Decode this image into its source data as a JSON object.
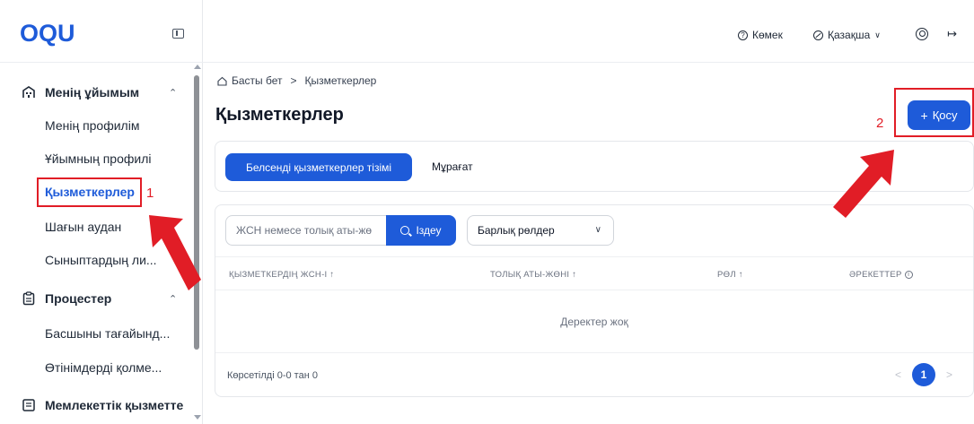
{
  "brand": {
    "logo": "OQU"
  },
  "header": {
    "help": "Көмек",
    "language": "Қазақша"
  },
  "sidebar": {
    "groups": [
      {
        "label": "Менің ұйымым",
        "items": [
          "Менің профилім",
          "Ұйымның профилі",
          "Қызметкерлер",
          "Шағын аудан",
          "Сыныптардың ли..."
        ]
      },
      {
        "label": "Процестер",
        "items": [
          "Басшыны тағайынд...",
          "Өтінімдерді қолме..."
        ]
      },
      {
        "label": "Мемлекеттік қызметте",
        "items": []
      }
    ],
    "active_item": "Қызметкерлер"
  },
  "breadcrumb": {
    "home": "Басты бет",
    "current": "Қызметкерлер"
  },
  "page": {
    "title": "Қызметкерлер",
    "add_button": "Қосу"
  },
  "tabs": {
    "active": "Белсенді қызметкерлер тізімі",
    "archive": "Мұрағат"
  },
  "filters": {
    "search_placeholder": "ЖСН немесе толық аты-жө",
    "search_button": "Іздеу",
    "role_select": "Барлық рөлдер"
  },
  "table": {
    "columns": [
      "ҚЫЗМЕТКЕРДІҢ ЖСН-І",
      "ТОЛЫҚ АТЫ-ЖӨНІ",
      "РӨЛ",
      "ӘРЕКЕТТЕР"
    ],
    "empty_text": "Деректер жоқ"
  },
  "footer": {
    "shown": "Көрсетілді 0-0 тан 0",
    "page": "1"
  },
  "annotations": {
    "step1": "1",
    "step2": "2"
  },
  "colors": {
    "accent": "#1e5bd9",
    "annotation": "#e11d26"
  }
}
